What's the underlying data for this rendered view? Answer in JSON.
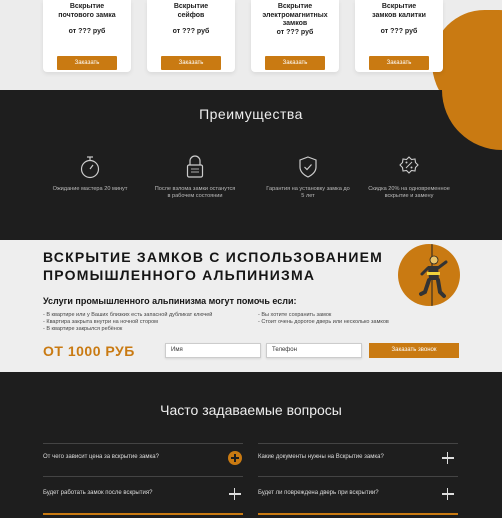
{
  "cards": [
    {
      "title": "Вскрытие почтового замка",
      "price": "от ??? руб",
      "button": "Заказать"
    },
    {
      "title": "Вскрытие сейфов",
      "price": "от ??? руб",
      "button": "Заказать"
    },
    {
      "title": "Вскрытие электромагнитных замков",
      "price": "от ??? руб",
      "button": "Заказать"
    },
    {
      "title": "Вскрытие замков калитки",
      "price": "от ??? руб",
      "button": "Заказать"
    }
  ],
  "advantages": {
    "title": "Преимущества",
    "items": [
      {
        "icon": "stopwatch-icon",
        "text": "Ожидание мастера 20 минут"
      },
      {
        "icon": "padlock-icon",
        "text": "После взлома замки останутся в рабочем состоянии"
      },
      {
        "icon": "shield-check-icon",
        "text": "Гарантия на установку замка до 5 лет"
      },
      {
        "icon": "discount-badge-icon",
        "text": "Скидка 20% на одновременное вскрытие и замену"
      }
    ]
  },
  "alpinism": {
    "title": "ВСКРЫТИЕ ЗАМКОВ С ИСПОЛЬЗОВАНИЕМ ПРОМЫШЛЕННОГО АЛЬПИНИЗМА",
    "subtitle": "Услуги промышленного альпинизма могут помочь если:",
    "list_left": [
      "- В квартире или у Ваших близких есть запасной  дубликат ключей",
      "- Квартира закрыта внутри на ночной стором",
      "- В квартире закрылся ребёнок"
    ],
    "list_right": [
      "- Вы хотите сохранить замок",
      "- Стоит очень дорогое дверь или несколько замков"
    ],
    "price": "ОТ 1000 РУБ",
    "name_placeholder": "Имя",
    "phone_placeholder": "Телефон",
    "submit": "Заказать звонок"
  },
  "faq": {
    "title": "Часто задаваемые вопросы",
    "questions": [
      "От чего зависит цена за вскрытие замка?",
      "Какие документы нужны на Вскрытие замка?",
      "Будет работать замок после вскрытия?",
      "Будет ли повреждена дверь при вскрытии?"
    ]
  },
  "colors": {
    "accent": "#c97a12",
    "dark": "#1e1e1e",
    "light": "#eeeeee"
  }
}
